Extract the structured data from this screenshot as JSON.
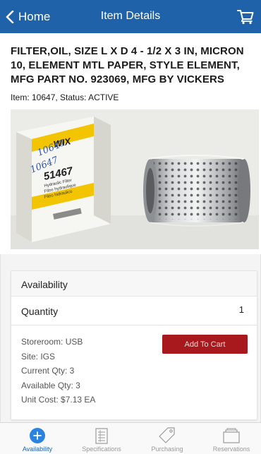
{
  "nav": {
    "back_label": "Home",
    "title": "Item Details",
    "bar_color": "#1f62a9",
    "cart_icon": "cart-icon",
    "back_icon": "chevron-left-icon"
  },
  "item": {
    "title": "FILTER,OIL, SIZE L X D 4 - 1/2 X 3 IN, MICRON 10, ELEMENT MTL PAPER, STYLE ELEMENT, MFG PART NO. 923069, MFG BY VICKERS",
    "status_line": "Item: 10647, Status: ACTIVE"
  },
  "photo": {
    "box_brand": "WIX",
    "box_part": "51467",
    "box_subtitle": "Hydraulic Filter",
    "box_line2": "Filtre hydraulique",
    "box_line3": "Filtro hidraulico",
    "handwriting": "10647"
  },
  "availability": {
    "header": "Availability",
    "quantity_label": "Quantity",
    "quantity_value": "1",
    "details": [
      "Storeroom: USB",
      "Site: IGS",
      "Current Qty: 3",
      "Available Qty: 3",
      "Unit Cost: $7.13 EA"
    ],
    "add_button": "Add To Cart",
    "button_color": "#a8191e"
  },
  "tabs": [
    {
      "label": "Availability",
      "icon": "plus-circle-icon",
      "active": true
    },
    {
      "label": "Specifications",
      "icon": "list-icon",
      "active": false
    },
    {
      "label": "Purchasing",
      "icon": "tag-icon",
      "active": false
    },
    {
      "label": "Reservations",
      "icon": "tray-icon",
      "active": false
    }
  ]
}
